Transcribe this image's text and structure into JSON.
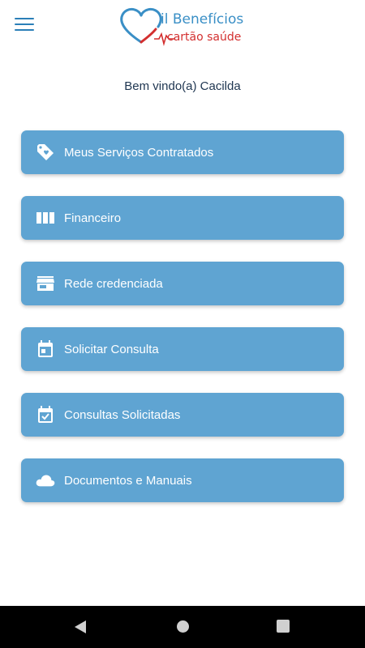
{
  "logo": {
    "line1": "il Benefícios",
    "line2": "cartão saúde"
  },
  "welcome_text": "Bem vindo(a) Cacilda",
  "menu_items": [
    {
      "label": "Meus Serviços Contratados",
      "icon": "tag-heart-icon"
    },
    {
      "label": "Financeiro",
      "icon": "columns-icon"
    },
    {
      "label": "Rede credenciada",
      "icon": "store-icon"
    },
    {
      "label": "Solicitar Consulta",
      "icon": "calendar-icon"
    },
    {
      "label": "Consultas Solicitadas",
      "icon": "calendar-check-icon"
    },
    {
      "label": "Documentos e Manuais",
      "icon": "cloud-icon"
    }
  ],
  "colors": {
    "primary": "#5fa4d2",
    "brand_blue": "#3a8fc6",
    "brand_red": "#d32f2f",
    "text_dark": "#1e3550"
  },
  "nav": {
    "back": "back-icon",
    "home": "home-icon",
    "recent": "recent-apps-icon"
  }
}
